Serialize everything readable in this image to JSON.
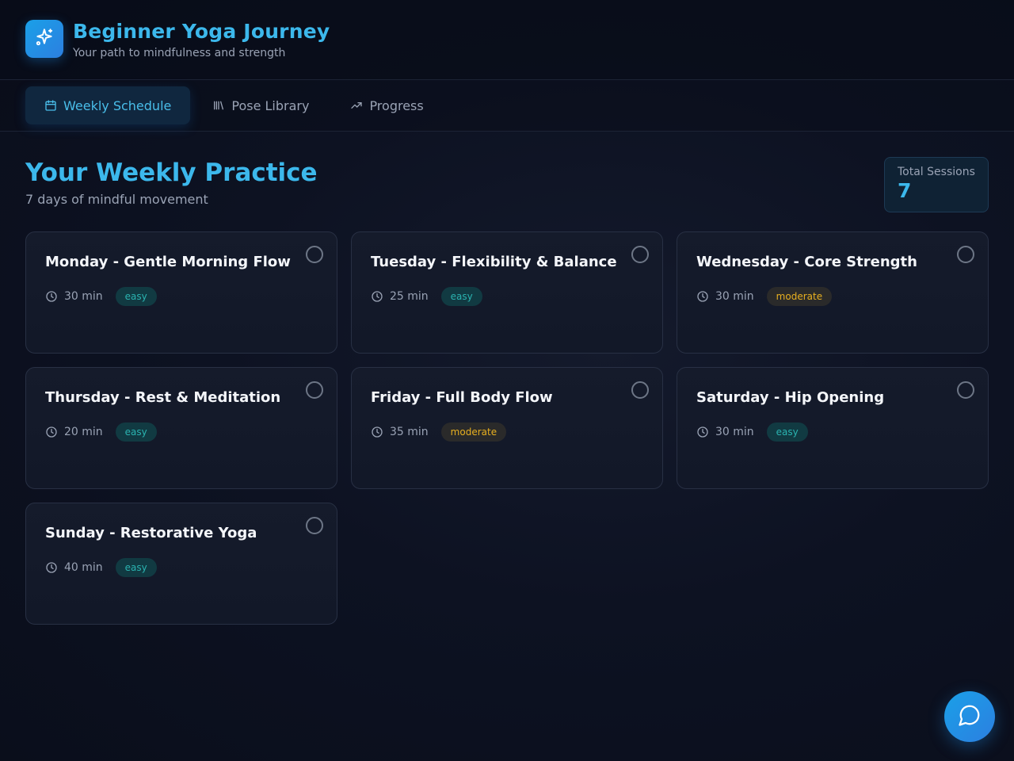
{
  "app": {
    "title": "Beginner Yoga Journey",
    "subtitle": "Your path to mindfulness and strength",
    "logo_icon": "sparkles-icon",
    "accent": "#3cb8ec"
  },
  "tabs": [
    {
      "label": "Weekly Schedule",
      "icon": "calendar-icon",
      "active": true
    },
    {
      "label": "Pose Library",
      "icon": "library-icon",
      "active": false
    },
    {
      "label": "Progress",
      "icon": "trending-up-icon",
      "active": false
    }
  ],
  "page": {
    "title": "Your Weekly Practice",
    "subtitle": "7 days of mindful movement"
  },
  "stats": {
    "label": "Total Sessions",
    "value": "7"
  },
  "sessions": [
    {
      "title": "Monday - Gentle Morning Flow",
      "duration": "30 min",
      "level": "easy",
      "completed": false
    },
    {
      "title": "Tuesday - Flexibility & Balance",
      "duration": "25 min",
      "level": "easy",
      "completed": false
    },
    {
      "title": "Wednesday - Core Strength",
      "duration": "30 min",
      "level": "moderate",
      "completed": false
    },
    {
      "title": "Thursday - Rest & Meditation",
      "duration": "20 min",
      "level": "easy",
      "completed": false
    },
    {
      "title": "Friday - Full Body Flow",
      "duration": "35 min",
      "level": "moderate",
      "completed": false
    },
    {
      "title": "Saturday - Hip Opening",
      "duration": "30 min",
      "level": "easy",
      "completed": false
    },
    {
      "title": "Sunday - Restorative Yoga",
      "duration": "40 min",
      "level": "easy",
      "completed": false
    }
  ],
  "colors": {
    "easy_badge_text": "#2ab3b0",
    "moderate_badge_text": "#e8b020"
  },
  "chat": {
    "icon": "chat-bubble-icon"
  }
}
